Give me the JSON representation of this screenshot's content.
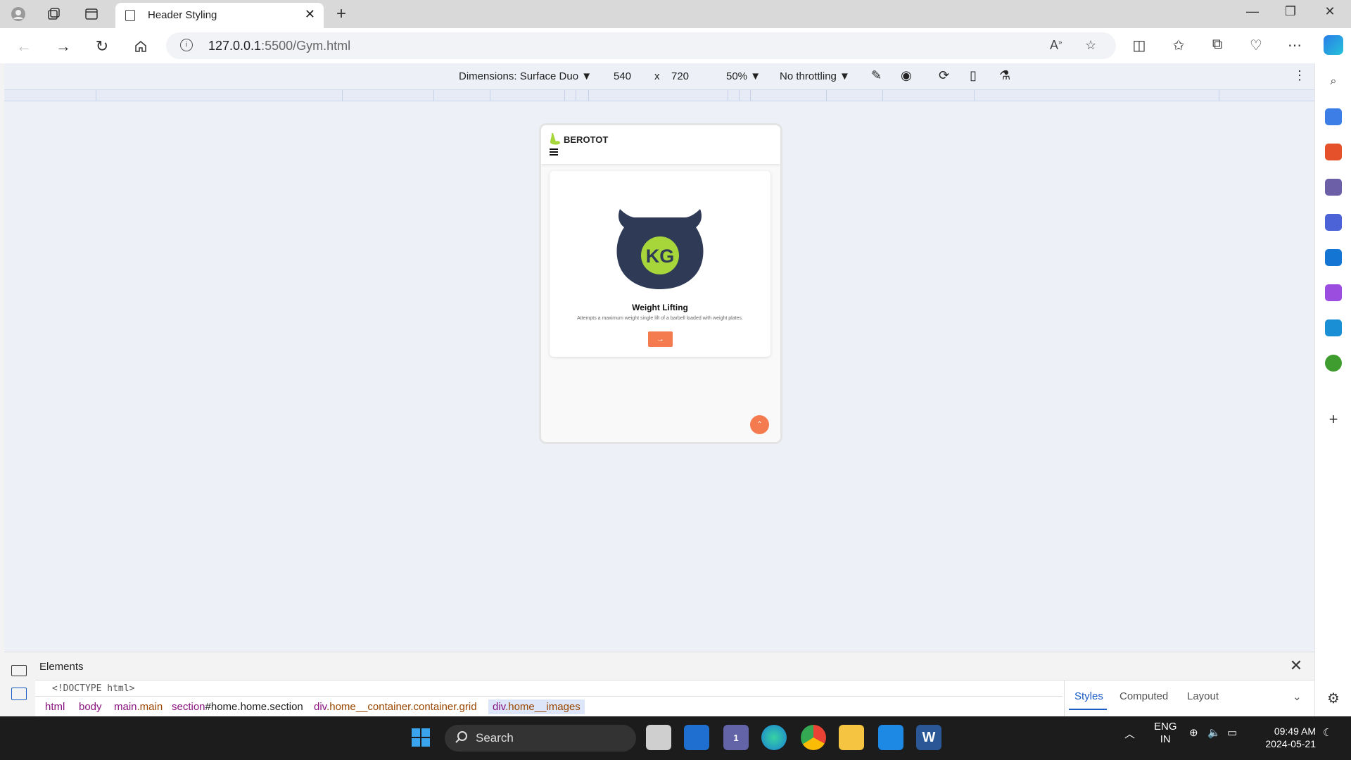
{
  "browser": {
    "tab_title": "Header Styling",
    "url_host": "127.0.0.1",
    "url_rest": ":5500/Gym.html"
  },
  "device_toolbar": {
    "dimensions": "Dimensions: Surface Duo",
    "width": "540",
    "times": "x",
    "height": "720",
    "zoom": "50%",
    "throttling": "No throttling"
  },
  "page": {
    "logo_text": "BEROTOT",
    "badge_text": "KG",
    "card_title": "Weight Lifting",
    "card_description": "Attempts a maximum weight single lift of a barbell loaded with weight plates.",
    "card_button": "→",
    "scroll_top": "⌃"
  },
  "devtools": {
    "panel_title": "Elements",
    "doctype": "<!DOCTYPE html>",
    "breadcrumbs": {
      "c1": "html",
      "c2": "body",
      "c3_tag": "main",
      "c3_cls": ".main",
      "c4_tag": "section",
      "c4_id": "#home.home.section",
      "c5_tag": "div",
      "c5_cls": ".home__container.container.grid",
      "c6_tag": "div",
      "c6_cls": ".home__images"
    },
    "tabs": {
      "styles": "Styles",
      "computed": "Computed",
      "layout": "Layout"
    }
  },
  "taskbar": {
    "search_label": "Search",
    "lang_top": "ENG",
    "lang_bottom": "IN",
    "time": "09:49 AM",
    "date": "2024-05-21",
    "teams_badge": "1"
  },
  "colors": {
    "accent_orange": "#f47b4f",
    "kettlebell_navy": "#2f3a56",
    "badge_green": "#a6d63a",
    "link_blue": "#1a5bc4"
  }
}
